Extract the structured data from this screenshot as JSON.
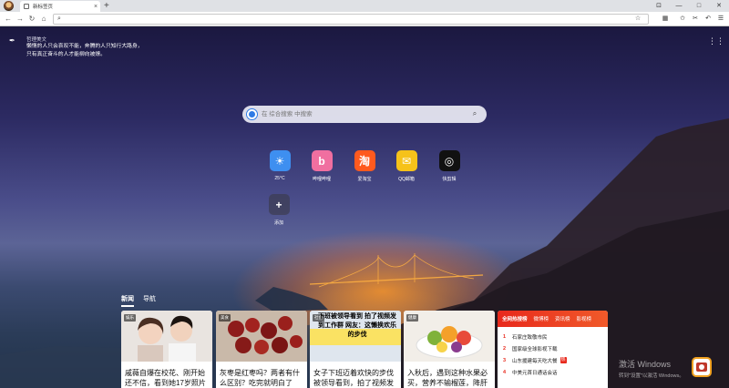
{
  "browser": {
    "tab_title": "新标签页",
    "tab_close": "×",
    "new_tab": "+",
    "window_controls": [
      "⊡",
      "—",
      "□",
      "✕"
    ],
    "nav": {
      "back": "←",
      "forward": "→",
      "refresh": "↻",
      "home": "⌂"
    },
    "address_value": "",
    "toolbar_icons": [
      "star-icon",
      "grid-icon",
      "bookmarks-icon",
      "cut-icon",
      "undo-icon",
      "menu-icon"
    ]
  },
  "quote": {
    "title": "哲理美文",
    "text": "懒惰的人只会哀叹不能，奔腾的人只知行大路身，只有真正奋斗的人才能柳向被燎。"
  },
  "search": {
    "placeholder": "在 综合搜索 中搜索",
    "value": ""
  },
  "shortcuts": [
    {
      "label": "25°C",
      "icon": "sun-icon",
      "color": "#3e8ff0",
      "glyph": "☀"
    },
    {
      "label": "哔哩哔哩",
      "icon": "bilibili-icon",
      "color": "#f06fa0",
      "glyph": "b"
    },
    {
      "label": "爱淘宝",
      "icon": "taobao-icon",
      "color": "#ff5a1e",
      "glyph": "淘"
    },
    {
      "label": "QQ邮箱",
      "icon": "mail-icon",
      "color": "#f6c21a",
      "glyph": "✉"
    },
    {
      "label": "快剪辑",
      "icon": "video-edit-icon",
      "color": "#111111",
      "glyph": "◎"
    }
  ],
  "add_shortcut": {
    "label": "添加",
    "glyph": "+"
  },
  "news": {
    "tabs": [
      "新闻",
      "导航"
    ],
    "cards": [
      {
        "tag": "娱乐",
        "title": "戚薇自爆在校花、刚开始还不信，看到她17岁照片"
      },
      {
        "tag": "美食",
        "title": "灰枣是红枣吗？两者有什么区别？吃完就明白了"
      },
      {
        "tag": "社会",
        "caption": "下班被领导看到 拍了视频发到工作群 网友：这懒换欢乐的步伐",
        "title": "女子下班迈着欢快的步伐被领导看到，拍了视频发"
      },
      {
        "tag": "健康",
        "title": "入秋后，遇到这种水果必买，营养不输榴莲，降肝火"
      }
    ]
  },
  "hot": {
    "tabs": [
      "全网热搜榜",
      "微博榜",
      "资讯榜",
      "影视榜"
    ],
    "items": [
      {
        "rank": "1",
        "text": "石家庄致敬市民",
        "badge": ""
      },
      {
        "rank": "2",
        "text": "国家级全球影视下载",
        "badge": ""
      },
      {
        "rank": "3",
        "text": "山东援建每天吃大餐",
        "badge": "热"
      },
      {
        "rank": "4",
        "text": "中美元首日通话会话",
        "badge": ""
      }
    ]
  },
  "system": {
    "activate_title": "激活 Windows",
    "activate_sub": "转到\"设置\"以激活 Windows。"
  },
  "colors": {
    "accent": "#e8291c",
    "search_blue": "#2f7be5"
  }
}
